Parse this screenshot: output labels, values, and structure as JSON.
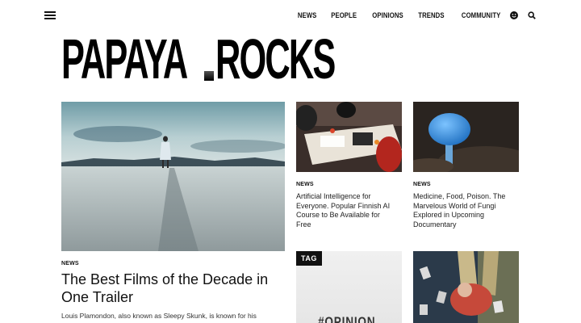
{
  "header": {
    "nav": [
      "NEWS",
      "PEOPLE",
      "OPINIONS",
      "TRENDS",
      "COMMUNITY"
    ],
    "icons": [
      "menu-icon",
      "smiley-icon",
      "search-icon"
    ]
  },
  "logo": {
    "left": "PAPAYA",
    "right": "ROCKS"
  },
  "featured": {
    "category": "NEWS",
    "title": "The Best Films of the Decade in One Trailer",
    "excerpt": "Louis Plamondon, also known as Sleepy Skunk, is known for his"
  },
  "card_ai": {
    "category": "NEWS",
    "title": "Artificial Intelligence for Everyone. Popular Finnish AI Course to Be Available for Free"
  },
  "card_fungi": {
    "category": "NEWS",
    "title": "Medicine, Food, Poison. The Marvelous World of Fungi Explored in Upcoming Documentary"
  },
  "tag_card": {
    "badge": "TAG",
    "text": "#OPINION"
  },
  "colors": {
    "accent": "#111111",
    "mushroom": "#3a8fd6",
    "sky": "#8fb4bd"
  }
}
